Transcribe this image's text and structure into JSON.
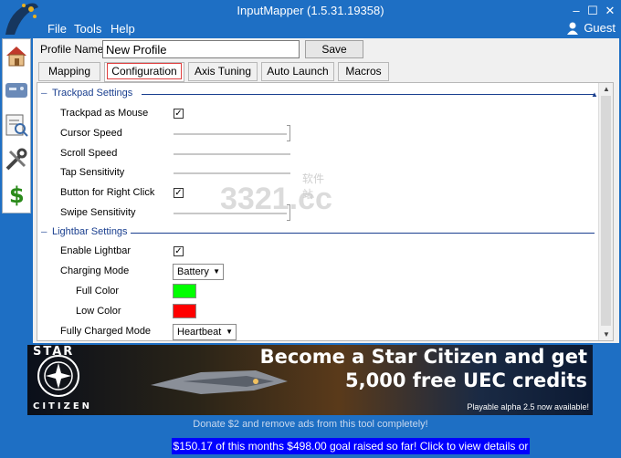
{
  "window": {
    "title": "InputMapper (1.5.31.19358)",
    "min": "–",
    "max": "☐",
    "close": "✕"
  },
  "menu": {
    "file": "File",
    "tools": "Tools",
    "help": "Help",
    "user": "Guest"
  },
  "sidebar": [
    "home-icon",
    "gamepad-icon",
    "profiles-icon",
    "tools-icon",
    "donate-icon"
  ],
  "profile": {
    "label": "Profile Name",
    "value": "New Profile",
    "save": "Save"
  },
  "tabs": [
    "Mapping",
    "Configuration",
    "Axis Tuning",
    "Auto Launch",
    "Macros"
  ],
  "trackpad": {
    "title": "Trackpad Settings",
    "as_mouse": {
      "label": "Trackpad as Mouse",
      "checked": true
    },
    "cursor_speed": {
      "label": "Cursor Speed",
      "value": 1.0
    },
    "scroll_speed": {
      "label": "Scroll Speed"
    },
    "tap_sensitivity": {
      "label": "Tap Sensitivity"
    },
    "right_click": {
      "label": "Button for Right Click",
      "checked": true
    },
    "swipe_sensitivity": {
      "label": "Swipe Sensitivity",
      "value": 1.0
    }
  },
  "lightbar": {
    "title": "Lightbar Settings",
    "enable": {
      "label": "Enable Lightbar",
      "checked": true
    },
    "charging_mode": {
      "label": "Charging Mode",
      "value": "Battery"
    },
    "full_color": {
      "label": "Full Color",
      "color": "#00ff00"
    },
    "low_color": {
      "label": "Low Color",
      "color": "#ff0000"
    },
    "fully_charged_mode": {
      "label": "Fully Charged Mode",
      "value": "Heartbeat"
    }
  },
  "watermark": {
    "text": "3321.cc",
    "sub": "软件站"
  },
  "ad": {
    "brand_top": "STAR",
    "brand_bottom": "CITIZEN",
    "line1": "Become a Star Citizen and get",
    "line2": "5,000 free UEC credits",
    "note": "Playable alpha 2.5 now available!"
  },
  "donate": "Donate $2 and remove ads from this tool completely!",
  "goal": "$150.17 of this months $498.00 goal raised so far!  Click to view details or help!"
}
